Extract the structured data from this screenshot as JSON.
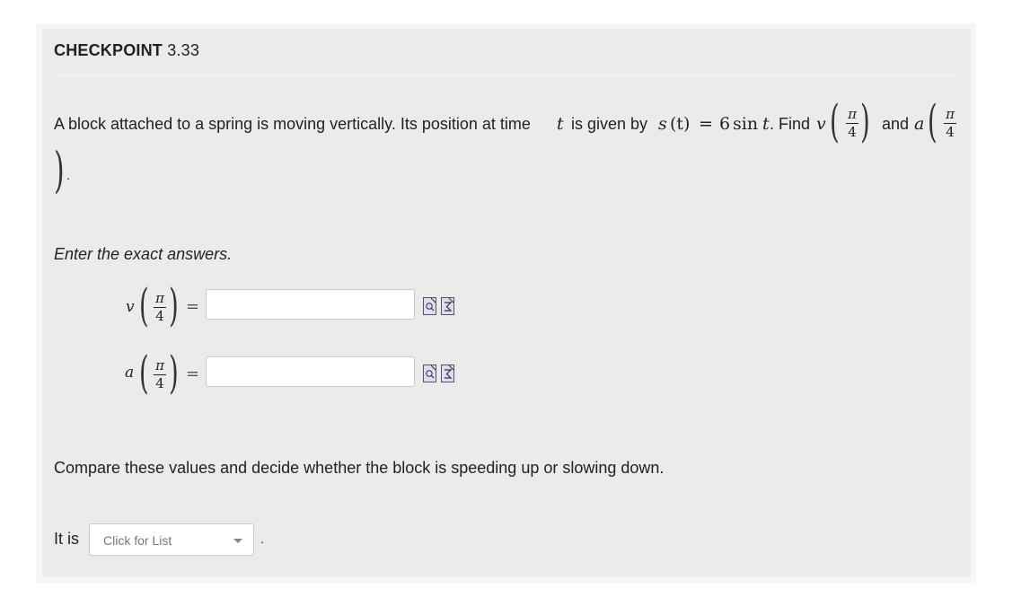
{
  "checkpoint": {
    "label": "CHECKPOINT",
    "number": "3.33"
  },
  "problem": {
    "intro": "A block attached to a spring is moving vertically. Its position at time",
    "t": "t",
    "given_by": "is given by",
    "s": "s",
    "t_arg": "(t)",
    "equals": "=",
    "rhs_num": "6",
    "rhs_sin": "sin",
    "rhs_t": "t",
    "find": ". Find",
    "v": "v",
    "and": "and",
    "a": "a",
    "pi": "π",
    "four": "4",
    "period": "."
  },
  "instruction": "Enter the exact answers.",
  "answers": [
    {
      "var": "v",
      "pi": "π",
      "den": "4",
      "eq": "=",
      "value": ""
    },
    {
      "var": "a",
      "pi": "π",
      "den": "4",
      "eq": "=",
      "value": ""
    }
  ],
  "icons": {
    "preview": "preview-magnifier-icon",
    "equation": "sigma-equation-icon"
  },
  "compare": "Compare these values and decide whether the block is speeding up or slowing down.",
  "conclusion": {
    "prefix": "It is",
    "dropdown_placeholder": "Click for List",
    "suffix": "."
  },
  "colors": {
    "panel": "#ebebeb",
    "icon_fill": "#dcdcf4",
    "text": "#222222"
  }
}
